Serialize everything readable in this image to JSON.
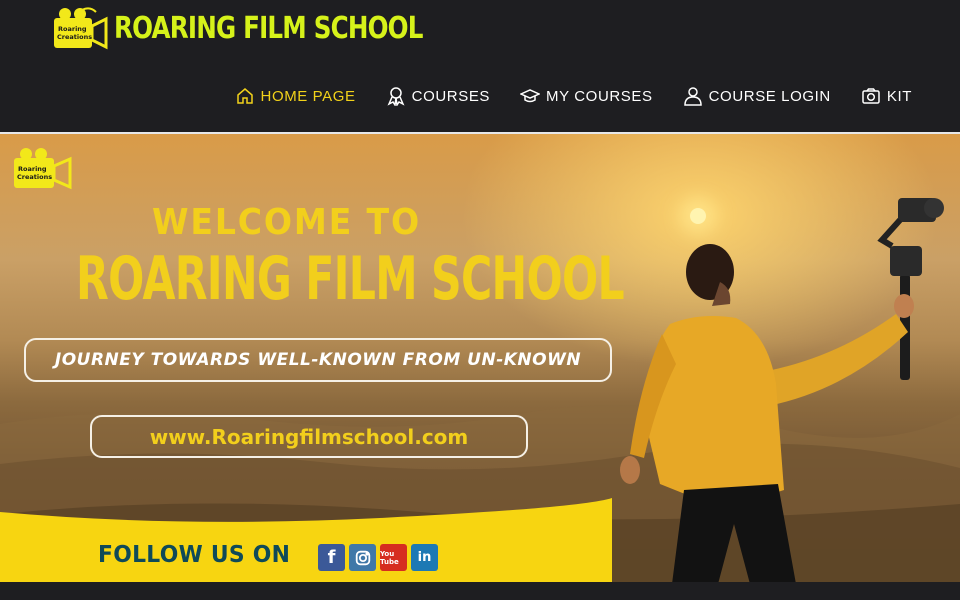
{
  "site": {
    "name": "ROARING FILM SCHOOL",
    "logo_badge_text": [
      "Roaring",
      "Creations"
    ]
  },
  "nav": {
    "items": [
      {
        "label": "HOME PAGE",
        "icon": "home-icon",
        "active": true
      },
      {
        "label": "COURSES",
        "icon": "award-icon",
        "active": false
      },
      {
        "label": "MY COURSES",
        "icon": "graduation-cap-icon",
        "active": false
      },
      {
        "label": "COURSE LOGIN",
        "icon": "user-icon",
        "active": false
      },
      {
        "label": "KIT",
        "icon": "camera-icon",
        "active": false
      }
    ]
  },
  "banner": {
    "welcome": "WELCOME TO",
    "title": "ROARING FILM SCHOOL",
    "tagline": "JOURNEY TOWARDS WELL-KNOWN FROM UN-KNOWN",
    "url": "www.Roaringfilmschool.com",
    "follow": "FOLLOW US ON",
    "socials": [
      {
        "name": "facebook",
        "label": "f"
      },
      {
        "name": "instagram",
        "label": ""
      },
      {
        "name": "youtube",
        "label": "You Tube"
      },
      {
        "name": "linkedin",
        "label": "in"
      }
    ]
  },
  "colors": {
    "header_bg": "#1e1e21",
    "brand_lime": "#d6f21a",
    "accent_yellow": "#f2d21a",
    "follow_band": "#f7d511",
    "follow_text": "#0f4a58"
  }
}
